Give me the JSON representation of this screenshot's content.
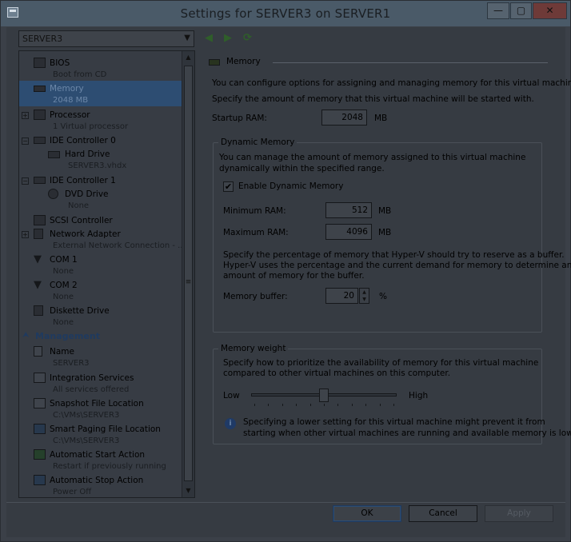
{
  "window": {
    "title": "Settings for SERVER3 on SERVER1",
    "minimize": "—",
    "maximize": "▢",
    "close": "✕"
  },
  "vm_selector": {
    "value": "SERVER3"
  },
  "tree": {
    "items": [
      {
        "label": "BIOS",
        "sub": "Boot from CD"
      },
      {
        "label": "Memory",
        "sub": "2048 MB"
      },
      {
        "label": "Processor",
        "sub": "1 Virtual processor"
      },
      {
        "label": "IDE Controller 0",
        "sub": ""
      },
      {
        "label": "Hard Drive",
        "sub": "SERVER3.vhdx"
      },
      {
        "label": "IDE Controller 1",
        "sub": ""
      },
      {
        "label": "DVD Drive",
        "sub": "None"
      },
      {
        "label": "SCSI Controller",
        "sub": ""
      },
      {
        "label": "Network Adapter",
        "sub": "External Network Connection - ..."
      },
      {
        "label": "COM 1",
        "sub": "None"
      },
      {
        "label": "COM 2",
        "sub": "None"
      },
      {
        "label": "Diskette Drive",
        "sub": "None"
      }
    ],
    "management_header": "Management",
    "management": [
      {
        "label": "Name",
        "sub": "SERVER3"
      },
      {
        "label": "Integration Services",
        "sub": "All services offered"
      },
      {
        "label": "Snapshot File Location",
        "sub": "C:\\VMs\\SERVER3"
      },
      {
        "label": "Smart Paging File Location",
        "sub": "C:\\VMs\\SERVER3"
      },
      {
        "label": "Automatic Start Action",
        "sub": "Restart if previously running"
      },
      {
        "label": "Automatic Stop Action",
        "sub": "Power Off"
      }
    ]
  },
  "memory": {
    "header": "Memory",
    "intro1": "You can configure options for assigning and managing memory for this virtual machine.",
    "intro2": "Specify the amount of memory that this virtual machine will be started with.",
    "startup_label": "Startup RAM:",
    "startup_value": "2048",
    "unit_mb": "MB",
    "dynamic": {
      "title": "Dynamic Memory",
      "desc1": "You can manage the amount of memory assigned to this virtual machine",
      "desc2": "dynamically within the specified range.",
      "enable_label": "Enable Dynamic Memory",
      "enable_checked": "✔",
      "min_label": "Minimum RAM:",
      "min_value": "512",
      "max_label": "Maximum RAM:",
      "max_value": "4096",
      "buffer_desc1": "Specify the percentage of memory that Hyper-V should try to reserve as a buffer.",
      "buffer_desc2": "Hyper-V uses the percentage and the current demand for memory to determine an",
      "buffer_desc3": "amount of memory for the buffer.",
      "buffer_label": "Memory buffer:",
      "buffer_value": "20",
      "buffer_unit": "%"
    },
    "weight": {
      "title": "Memory weight",
      "desc1": "Specify how to prioritize the availability of memory for this virtual machine",
      "desc2": "compared to other virtual machines on this computer.",
      "low": "Low",
      "high": "High",
      "slider_fraction": 0.5,
      "info1": "Specifying a lower setting for this virtual machine might prevent it from",
      "info2": "starting when other virtual machines are running and available memory is low."
    }
  },
  "buttons": {
    "ok": "OK",
    "cancel": "Cancel",
    "apply": "Apply"
  }
}
